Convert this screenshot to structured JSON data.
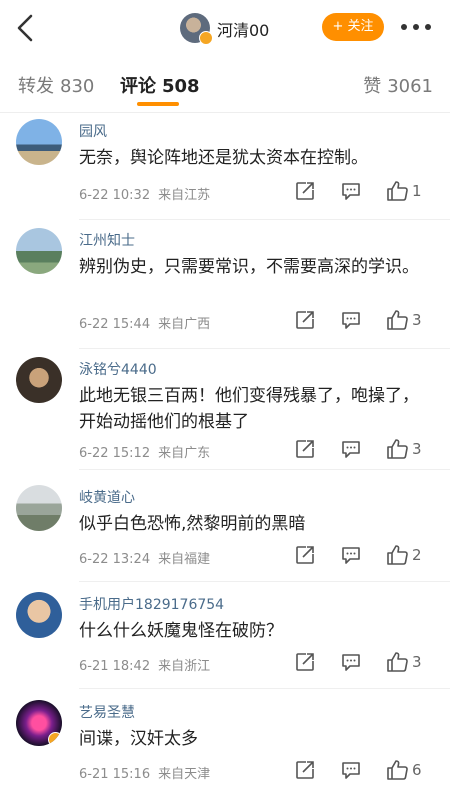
{
  "header": {
    "username": "河清00",
    "follow_label": "+ 关注"
  },
  "tabs": {
    "repost": {
      "label": "转发",
      "count": "830"
    },
    "comments": {
      "label": "评论",
      "count": "508"
    },
    "likes": {
      "label": "赞",
      "count": "3061"
    }
  },
  "comments": [
    {
      "name": "园风",
      "text": "无奈，舆论阵地还是犹太资本在控制。",
      "date": "6-22 10:32",
      "location": "来自江苏",
      "likes": "1"
    },
    {
      "name": "江州知士",
      "text": "辨别伪史，只需要常识，不需要高深的学识。",
      "date": "6-22 15:44",
      "location": "来自广西",
      "likes": "3"
    },
    {
      "name": "泳铭兮4440",
      "text": "此地无银三百两！他们变得残暴了，咆操了，开始动摇他们的根基了",
      "date": "6-22 15:12",
      "location": "来自广东",
      "likes": "3"
    },
    {
      "name": "岐黄道心",
      "text": "似乎白色恐怖,然黎明前的黑暗",
      "date": "6-22 13:24",
      "location": "来自福建",
      "likes": "2"
    },
    {
      "name": "手机用户1829176754",
      "text": "什么什么妖魔鬼怪在破防？",
      "date": "6-21 18:42",
      "location": "来自浙江",
      "likes": "3"
    },
    {
      "name": "艺易圣慧",
      "text": "间谍，汉奸太多",
      "date": "6-21 15:16",
      "location": "来自天津",
      "likes": "6"
    }
  ],
  "colors": {
    "accent": "#ff8f00",
    "verified": "#f5a623",
    "name": "#4a6b8a"
  }
}
